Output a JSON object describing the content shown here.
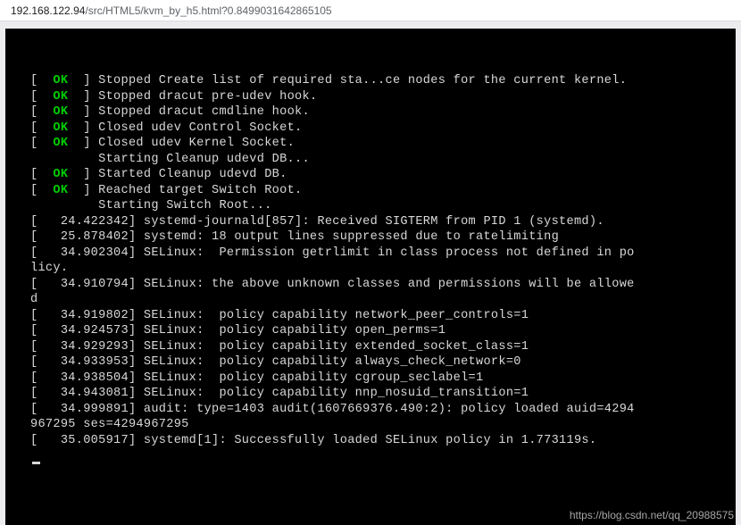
{
  "url": {
    "host": "192.168.122.94",
    "path": "/src/HTML5/kvm_by_h5.html?0.8499031642865105"
  },
  "terminal": {
    "lines": [
      {
        "prefix": "[  ",
        "status": "OK",
        "suffix": "  ] ",
        "msg": "Stopped Create list of required sta...ce nodes for the current kernel."
      },
      {
        "prefix": "[  ",
        "status": "OK",
        "suffix": "  ] ",
        "msg": "Stopped dracut pre-udev hook."
      },
      {
        "prefix": "[  ",
        "status": "OK",
        "suffix": "  ] ",
        "msg": "Stopped dracut cmdline hook."
      },
      {
        "prefix": "[  ",
        "status": "OK",
        "suffix": "  ] ",
        "msg": "Closed udev Control Socket."
      },
      {
        "prefix": "[  ",
        "status": "OK",
        "suffix": "  ] ",
        "msg": "Closed udev Kernel Socket."
      },
      {
        "prefix": "",
        "status": "",
        "suffix": "         ",
        "msg": "Starting Cleanup udevd DB..."
      },
      {
        "prefix": "[  ",
        "status": "OK",
        "suffix": "  ] ",
        "msg": "Started Cleanup udevd DB."
      },
      {
        "prefix": "[  ",
        "status": "OK",
        "suffix": "  ] ",
        "msg": "Reached target Switch Root."
      },
      {
        "prefix": "",
        "status": "",
        "suffix": "         ",
        "msg": "Starting Switch Root..."
      },
      {
        "prefix": "",
        "status": "",
        "suffix": "",
        "msg": "[   24.422342] systemd-journald[857]: Received SIGTERM from PID 1 (systemd)."
      },
      {
        "prefix": "",
        "status": "",
        "suffix": "",
        "msg": "[   25.878402] systemd: 18 output lines suppressed due to ratelimiting"
      },
      {
        "prefix": "",
        "status": "",
        "suffix": "",
        "msg": "[   34.902304] SELinux:  Permission getrlimit in class process not defined in po"
      },
      {
        "prefix": "",
        "status": "",
        "suffix": "",
        "msg": "licy."
      },
      {
        "prefix": "",
        "status": "",
        "suffix": "",
        "msg": "[   34.910794] SELinux: the above unknown classes and permissions will be allowe"
      },
      {
        "prefix": "",
        "status": "",
        "suffix": "",
        "msg": "d"
      },
      {
        "prefix": "",
        "status": "",
        "suffix": "",
        "msg": "[   34.919802] SELinux:  policy capability network_peer_controls=1"
      },
      {
        "prefix": "",
        "status": "",
        "suffix": "",
        "msg": "[   34.924573] SELinux:  policy capability open_perms=1"
      },
      {
        "prefix": "",
        "status": "",
        "suffix": "",
        "msg": "[   34.929293] SELinux:  policy capability extended_socket_class=1"
      },
      {
        "prefix": "",
        "status": "",
        "suffix": "",
        "msg": "[   34.933953] SELinux:  policy capability always_check_network=0"
      },
      {
        "prefix": "",
        "status": "",
        "suffix": "",
        "msg": "[   34.938504] SELinux:  policy capability cgroup_seclabel=1"
      },
      {
        "prefix": "",
        "status": "",
        "suffix": "",
        "msg": "[   34.943081] SELinux:  policy capability nnp_nosuid_transition=1"
      },
      {
        "prefix": "",
        "status": "",
        "suffix": "",
        "msg": "[   34.999891] audit: type=1403 audit(1607669376.490:2): policy loaded auid=4294"
      },
      {
        "prefix": "",
        "status": "",
        "suffix": "",
        "msg": "967295 ses=4294967295"
      },
      {
        "prefix": "",
        "status": "",
        "suffix": "",
        "msg": "[   35.005917] systemd[1]: Successfully loaded SELinux policy in 1.773119s."
      }
    ]
  },
  "watermark": "https://blog.csdn.net/qq_20988575"
}
